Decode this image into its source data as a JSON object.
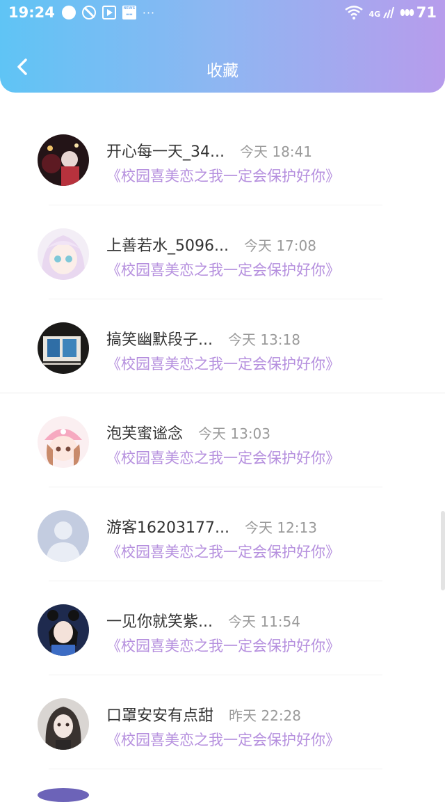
{
  "status_bar": {
    "time": "19:24",
    "signal_label": "4G",
    "battery": "71"
  },
  "nav": {
    "title": "收藏"
  },
  "items": [
    {
      "name": "开心每一天_34...",
      "time": "今天 18:41",
      "book": "《校园喜美恋之我一定会保护好你》"
    },
    {
      "name": "上善若水_5096...",
      "time": "今天 17:08",
      "book": "《校园喜美恋之我一定会保护好你》"
    },
    {
      "name": "搞笑幽默段子...",
      "time": "今天 13:18",
      "book": "《校园喜美恋之我一定会保护好你》"
    },
    {
      "name": "泡芙蜜谧念",
      "time": "今天 13:03",
      "book": "《校园喜美恋之我一定会保护好你》"
    },
    {
      "name": "游客16203177...",
      "time": "今天 12:13",
      "book": "《校园喜美恋之我一定会保护好你》"
    },
    {
      "name": "一见你就笑紫...",
      "time": "今天 11:54",
      "book": "《校园喜美恋之我一定会保护好你》"
    },
    {
      "name": "口罩安安有点甜",
      "time": "昨天 22:28",
      "book": "《校园喜美恋之我一定会保护好你》"
    }
  ],
  "colors": {
    "header_gradient_start": "#5fc4f5",
    "header_gradient_end": "#b79cec",
    "book_title": "#b58fde",
    "name_text": "#333333",
    "time_text": "#9a9a9a"
  }
}
